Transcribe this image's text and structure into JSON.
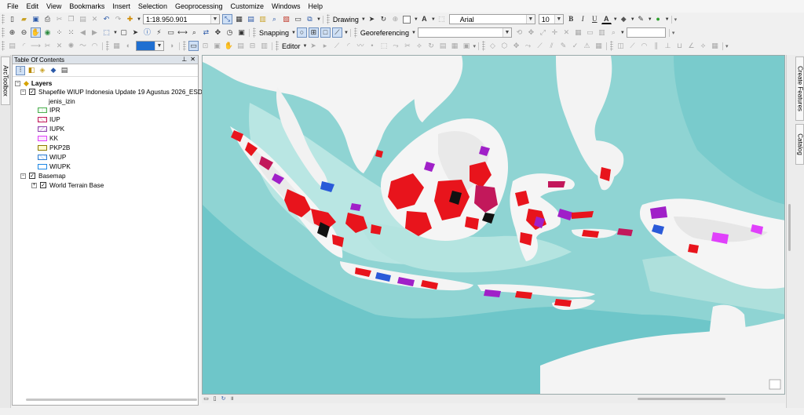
{
  "menu": [
    "File",
    "Edit",
    "View",
    "Bookmarks",
    "Insert",
    "Selection",
    "Geoprocessing",
    "Customize",
    "Windows",
    "Help"
  ],
  "toolbar": {
    "scale": "1:18.950.901",
    "drawing_label": "Drawing",
    "font_name": "Arial",
    "font_size": "10",
    "bold": "B",
    "italic": "I",
    "underline": "U",
    "font_color_glyph": "A",
    "text_glyph": "A",
    "snapping_label": "Snapping",
    "georeferencing_label": "Georeferencing",
    "editor_label": "Editor"
  },
  "left_tab": "ArcToolbox",
  "toc": {
    "title": "Table Of Contents",
    "root": "Layers",
    "layer1": {
      "name": "Shapefile WIUP Indonesia Update 19 Agustus 2026_ESDM",
      "field": "jenis_izin",
      "classes": [
        {
          "label": "IPR",
          "color": "#4caf50"
        },
        {
          "label": "IUP",
          "color": "#c2185b"
        },
        {
          "label": "IUPK",
          "color": "#8e44ad"
        },
        {
          "label": "KK",
          "color": "#e040fb"
        },
        {
          "label": "PKP2B",
          "color": "#8d7a00"
        },
        {
          "label": "WIUP",
          "color": "#2e7dd1"
        },
        {
          "label": "WIUPK",
          "color": "#1e88e5"
        }
      ]
    },
    "layer2": {
      "name": "Basemap",
      "child": "World Terrain Base"
    }
  },
  "right_tabs": [
    "Create Features",
    "Catalog"
  ],
  "colors": {
    "sea": "#8fd4d3",
    "shallow_sea": "#b9e6e3",
    "land": "#f4f4f4",
    "mining_red": "#e8141c",
    "mining_purple": "#a020c8",
    "mining_black": "#111111",
    "mining_blue": "#2a5ad8"
  }
}
